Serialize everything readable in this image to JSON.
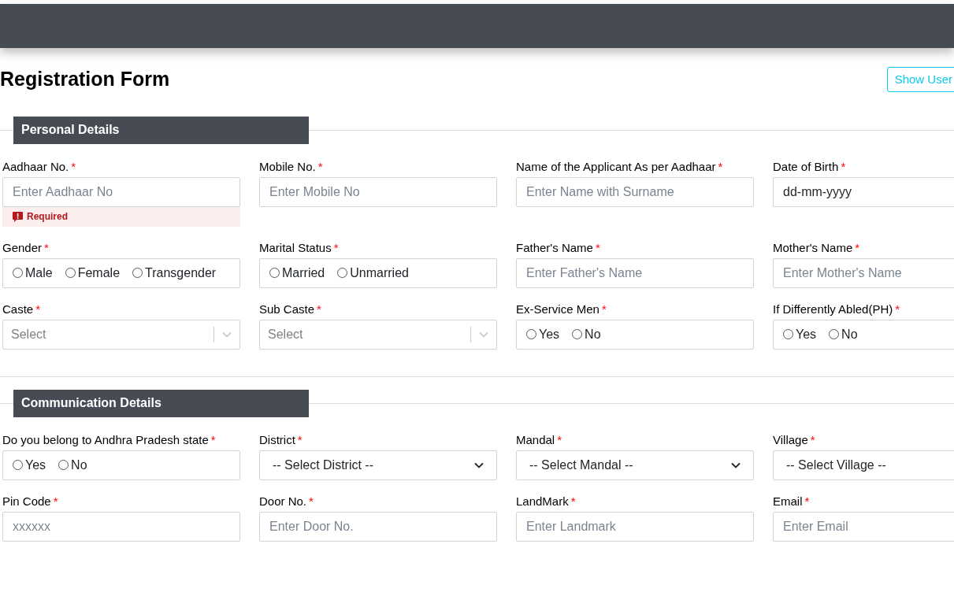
{
  "page": {
    "title": "Registration Form",
    "action": "Show User"
  },
  "sections": [
    {
      "title": "Personal Details",
      "fields": [
        {
          "kind": "text",
          "label": "Aadhaar No.",
          "mark": "*",
          "placeholder": "Enter Aadhaar No",
          "error": "Required"
        },
        {
          "kind": "text",
          "label": "Mobile No.",
          "mark": "*",
          "placeholder": "Enter Mobile No"
        },
        {
          "kind": "text",
          "label": "Name of the Applicant As per Aadhaar",
          "mark": "*",
          "placeholder": "Enter Name with Surname"
        },
        {
          "kind": "date",
          "label": "Date of Birth",
          "mark": "*",
          "value": "dd-mm-yyyy"
        },
        {
          "kind": "radio",
          "label": "Gender",
          "mark": "*",
          "options": [
            {
              "label": "Male",
              "selected": false
            },
            {
              "label": "Female",
              "selected": false
            },
            {
              "label": "Transgender",
              "selected": false
            }
          ]
        },
        {
          "kind": "radio",
          "label": "Marital Status",
          "mark": "*",
          "options": [
            {
              "label": "Married",
              "selected": false
            },
            {
              "label": "Unmarried",
              "selected": false
            }
          ]
        },
        {
          "kind": "text",
          "label": "Father's Name",
          "mark": "*",
          "placeholder": "Enter Father's Name"
        },
        {
          "kind": "text",
          "label": "Mother's Name",
          "mark": "*",
          "placeholder": "Enter Mother's Name"
        },
        {
          "kind": "combo",
          "label": "Caste",
          "mark": "*",
          "placeholder": "Select"
        },
        {
          "kind": "combo",
          "label": "Sub Caste",
          "mark": "*",
          "placeholder": "Select"
        },
        {
          "kind": "radio",
          "label": "Ex-Service Men",
          "mark": "*",
          "options": [
            {
              "label": "Yes",
              "selected": false
            },
            {
              "label": "No",
              "selected": false
            }
          ]
        },
        {
          "kind": "radio",
          "label": "If Differently Abled(PH)",
          "mark": "*",
          "options": [
            {
              "label": "Yes",
              "selected": false
            },
            {
              "label": "No",
              "selected": false
            }
          ]
        }
      ]
    },
    {
      "title": "Communication Details",
      "fields": [
        {
          "kind": "radio",
          "label": "Do you belong to Andhra Pradesh state",
          "mark": "*",
          "options": [
            {
              "label": "Yes",
              "selected": false
            },
            {
              "label": "No",
              "selected": false
            }
          ]
        },
        {
          "kind": "select",
          "label": "District",
          "mark": "*",
          "value": "-- Select District --"
        },
        {
          "kind": "select",
          "label": "Mandal",
          "mark": "*",
          "value": "-- Select Mandal --"
        },
        {
          "kind": "select",
          "label": "Village",
          "mark": "*",
          "value": "-- Select Village --"
        },
        {
          "kind": "text",
          "label": "Pin Code",
          "mark": "*",
          "placeholder": "xxxxxx"
        },
        {
          "kind": "text",
          "label": "Door No.",
          "mark": "*",
          "placeholder": "Enter Door No."
        },
        {
          "kind": "text",
          "label": "LandMark",
          "mark": "*",
          "placeholder": "Enter Landmark"
        },
        {
          "kind": "text",
          "label": "Email",
          "mark": "*",
          "placeholder": "Enter Email"
        }
      ]
    }
  ]
}
